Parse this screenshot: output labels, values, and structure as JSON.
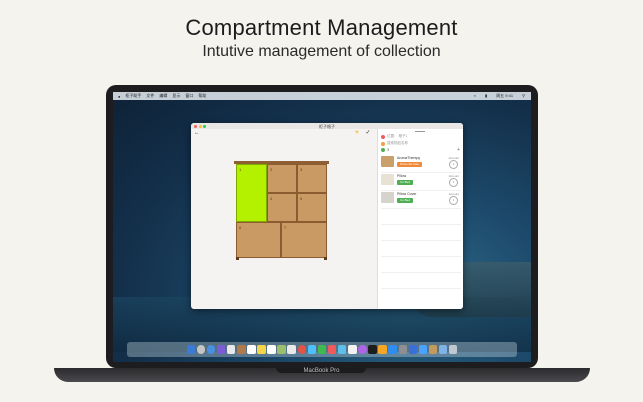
{
  "header": {
    "title": "Compartment Management",
    "subtitle": "Intutive management of collection"
  },
  "menubar": {
    "items": [
      "柜子助手",
      "文件",
      "编辑",
      "显示",
      "窗口",
      "帮助"
    ],
    "clock": "周五 9:41"
  },
  "window": {
    "title": "柜子格子"
  },
  "cabinet": {
    "cells": [
      {
        "label": "1",
        "selected": true
      },
      {
        "label": "2",
        "selected": false
      },
      {
        "label": "3",
        "selected": false
      },
      {
        "label": "4",
        "selected": false
      },
      {
        "label": "5",
        "selected": false
      },
      {
        "label": "6",
        "selected": false
      },
      {
        "label": "7",
        "selected": false
      }
    ]
  },
  "sidebar": {
    "location": "位置：  格子1",
    "search_placeholder": "搜索物品名称",
    "count": "3",
    "items": [
      {
        "name": "AromaTherapy",
        "tag": "Personal Care",
        "amount": "Amount",
        "qty": "1",
        "tag_color": "#f08a3a",
        "thumb_color": "#c9a06a"
      },
      {
        "name": "Pillow",
        "tag": "Co Bed",
        "amount": "Amount",
        "qty": "1",
        "tag_color": "#4fae54",
        "thumb_color": "#e8e2d5"
      },
      {
        "name": "Pillow Cover",
        "tag": "Co Bed",
        "amount": "Amount",
        "qty": "1",
        "tag_color": "#4fae54",
        "thumb_color": "#d6d2cc"
      }
    ]
  },
  "laptop": {
    "brand": "MacBook Pro"
  },
  "colors": {
    "selected_cell": "#b4f100",
    "cabinet_wood": "#c8935a"
  }
}
